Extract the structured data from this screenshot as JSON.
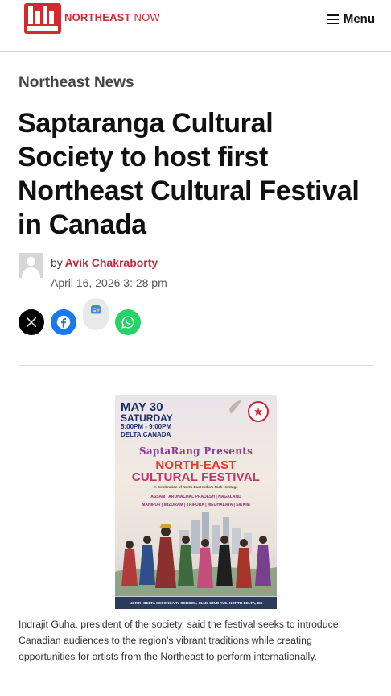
{
  "header": {
    "logo_word1": "NORTHEAST",
    "logo_word2": "NOW",
    "menu_label": "Menu"
  },
  "article": {
    "category": "Northeast News",
    "title": "Saptaranga Cultural Society to host first Northeast Cultural Festival in Canada",
    "byline_prefix": "by",
    "author": "Avik Chakraborty",
    "date": "April 16, 2026 3: 28 pm",
    "caption": "Indrajit Guha, president of the society, said the festival seeks to introduce Canadian audiences to the region’s vibrant traditions while creating opportunities for artists from the Northeast to perform internationally."
  },
  "share": {
    "icons": [
      "x-icon",
      "facebook-icon",
      "google-news-icon",
      "whatsapp-icon"
    ]
  },
  "poster": {
    "date_line1": "MAY 30",
    "date_line2": "SATURDAY",
    "time": "5:00PM - 9:00PM",
    "city": "DELTA,CANADA",
    "presents": "SaptaRang Presents",
    "festival_line1": "NORTH-EAST",
    "festival_line2": "CULTURAL FESTIVAL",
    "tagline": "A Celebration of North East India's Rich Heritage",
    "states_line1": "ASSAM | ARUNACHAL PRADESH | NAGALAND",
    "states_line2": "MANIPUR | MIZORAM | TRIPURA | MEGHALAYA | SIKKIM",
    "venue": "NORTH DELTA SECONDARY SCHOOL, 11447 82ND AVE, NORTH DELTA, BC"
  },
  "colors": {
    "brand_red": "#d42a2e",
    "author_red": "#c8263d",
    "facebook_blue": "#1877f2",
    "whatsapp_green": "#25d366"
  }
}
